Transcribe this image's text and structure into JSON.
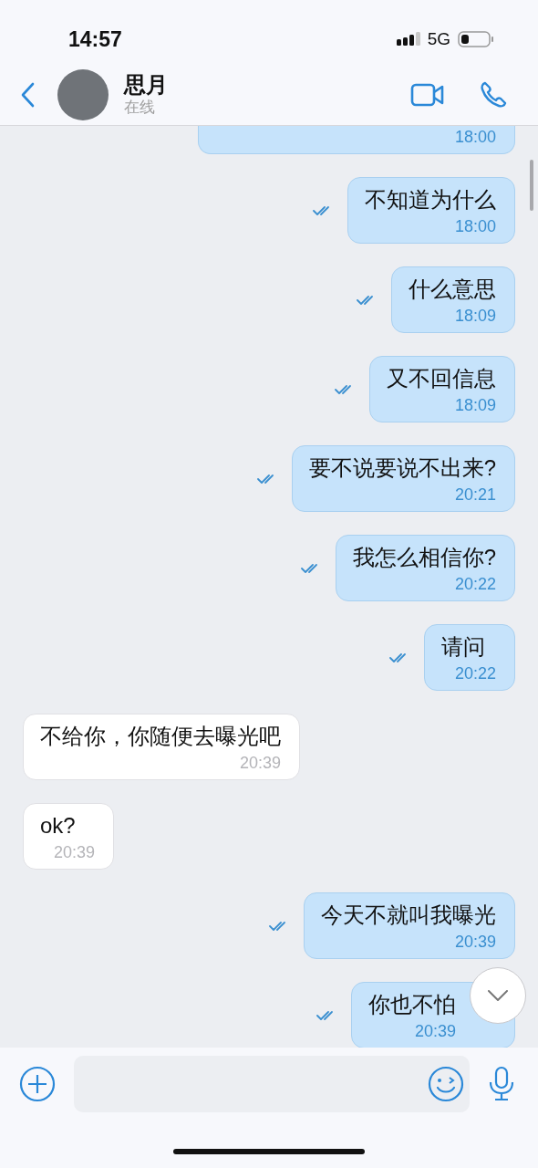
{
  "status_bar": {
    "time": "14:57",
    "network": "5G"
  },
  "header": {
    "contact_name": "思月",
    "presence": "在线"
  },
  "messages": [
    {
      "kind": "sent",
      "time": "18:00"
    },
    {
      "kind": "sent",
      "text": "不知道为什么",
      "time": "18:00",
      "read": true
    },
    {
      "kind": "sent",
      "text": "什么意思",
      "time": "18:09",
      "read": true
    },
    {
      "kind": "sent",
      "text": "又不回信息",
      "time": "18:09",
      "read": true
    },
    {
      "kind": "sent",
      "text": "要不说要说不出来?",
      "time": "20:21",
      "read": true
    },
    {
      "kind": "sent",
      "text": "我怎么相信你?",
      "time": "20:22",
      "read": true
    },
    {
      "kind": "sent",
      "text": "请问",
      "time": "20:22",
      "read": true
    },
    {
      "kind": "received",
      "text": "不给你，你随便去曝光吧",
      "time": "20:39"
    },
    {
      "kind": "received",
      "text": "ok?",
      "time": "20:39"
    },
    {
      "kind": "sent",
      "text": "今天不就叫我曝光",
      "time": "20:39",
      "read": true
    },
    {
      "kind": "sent",
      "text": "你也不怕",
      "time": "20:39",
      "read": true
    }
  ]
}
